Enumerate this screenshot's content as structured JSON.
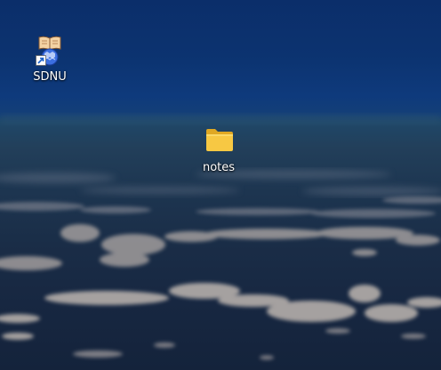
{
  "desktop": {
    "icons": [
      {
        "label": "SDNU",
        "icon": "sdnu-shortcut-icon",
        "is_shortcut": true
      },
      {
        "label": "notes",
        "icon": "folder-icon",
        "is_shortcut": false
      }
    ]
  },
  "colors": {
    "sky_top": "#0b2e6a",
    "horizon": "#1f4768",
    "cloud_sea": "#172741",
    "folder_yellow": "#f4c342",
    "label_text": "#ffffff"
  }
}
